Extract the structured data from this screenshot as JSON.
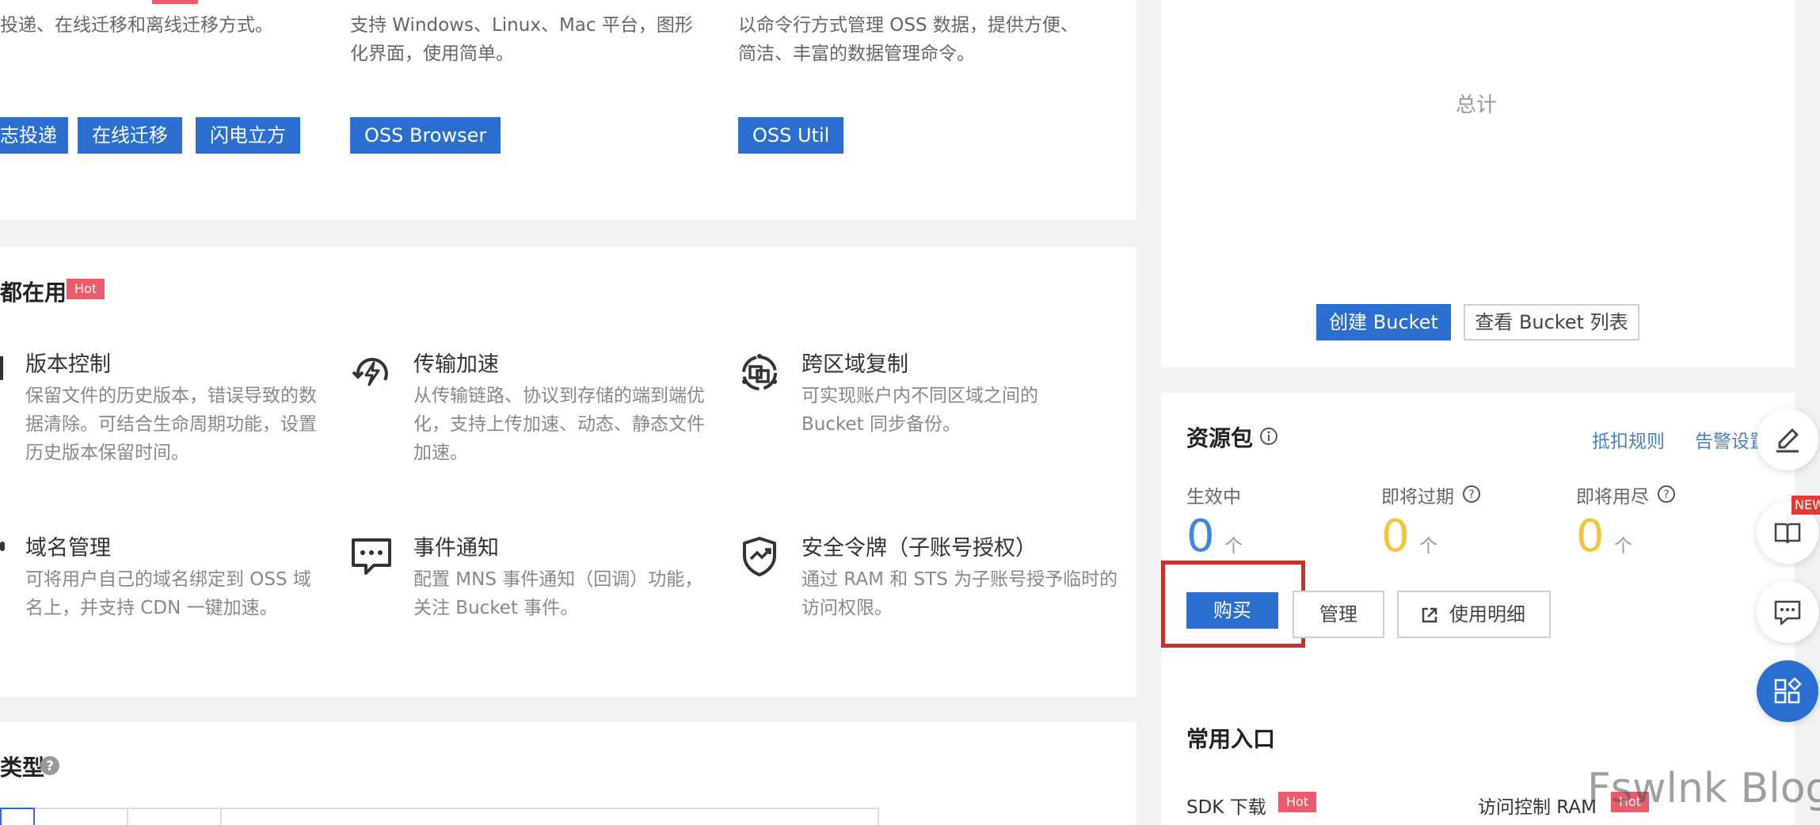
{
  "tools": [
    {
      "desc": "投递、在线迁移和离线迁移方式。",
      "buttons": [
        "志投递",
        "在线迁移",
        "闪电立方"
      ]
    },
    {
      "desc": "支持 Windows、Linux、Mac 平台，图形化界面，使用简单。",
      "buttons": [
        "OSS Browser"
      ]
    },
    {
      "desc": "以命令行方式管理 OSS 数据，提供方便、简洁、丰富的数据管理命令。",
      "buttons": [
        "OSS Util"
      ]
    }
  ],
  "features": {
    "title": "都在用",
    "hot": "Hot",
    "items": [
      {
        "icon": "version-control-icon",
        "title": "版本控制",
        "desc": "保留文件的历史版本，错误导致的数据清除。可结合生命周期功能，设置历史版本保留时间。"
      },
      {
        "icon": "transfer-acceleration-icon",
        "title": "传输加速",
        "desc": "从传输链路、协议到存储的端到端优化，支持上传加速、动态、静态文件加速。"
      },
      {
        "icon": "cross-region-replication-icon",
        "title": "跨区域复制",
        "desc": "可实现账户内不同区域之间的 Bucket 同步备份。"
      },
      {
        "icon": "domain-management-icon",
        "title": "域名管理",
        "desc": "可将用户自己的域名绑定到 OSS 域名上，并支持 CDN 一键加速。"
      },
      {
        "icon": "event-notification-icon",
        "title": "事件通知",
        "desc": "配置 MNS 事件通知（回调）功能，关注 Bucket 事件。"
      },
      {
        "icon": "security-token-icon",
        "title": "安全令牌（子账号授权）",
        "desc": "通过 RAM 和 STS 为子账号授予临时的访问权限。"
      }
    ]
  },
  "types": {
    "title": "类型"
  },
  "summary": {
    "total_label": "总计",
    "create_bucket": "创建 Bucket",
    "view_bucket_list": "查看 Bucket 列表"
  },
  "resource": {
    "title": "资源包",
    "rules_link": "抵扣规则",
    "alert_link": "告警设置",
    "stats": [
      {
        "label": "生效中",
        "value": "0",
        "unit": "个",
        "color": "#3d87e3"
      },
      {
        "label": "即将过期",
        "value": "0",
        "unit": "个",
        "color": "#f5c33b"
      },
      {
        "label": "即将用尽",
        "value": "0",
        "unit": "个",
        "color": "#f5c33b"
      }
    ],
    "buy": "购买",
    "manage": "管理",
    "usage_detail": "使用明细",
    "highlight_color": "#c8302a"
  },
  "quick": {
    "title": "常用入口",
    "sdk": "SDK 下载",
    "ram": "访问控制 RAM",
    "hot": "Hot"
  },
  "float_toolbar": {
    "new_badge": "NEW"
  },
  "watermark": "Fswlnk Blog"
}
